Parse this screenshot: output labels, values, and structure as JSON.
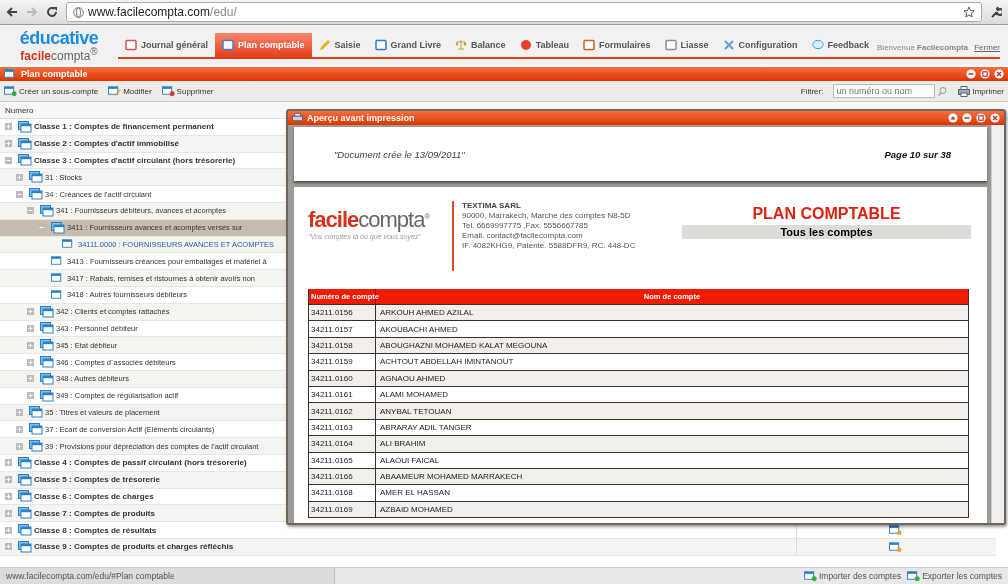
{
  "browser": {
    "url_host": "www.facilecompta.com",
    "url_path": "/edu/",
    "status": "www.facilecompta.com/edu/#Plan comptable"
  },
  "logo": {
    "top": "éducative",
    "brand_bold": "facile",
    "brand_light": "compta",
    "mark": "®"
  },
  "nav": [
    {
      "label": "Journal général",
      "selected": false
    },
    {
      "label": "Plan comptable",
      "selected": true
    },
    {
      "label": "Saisie",
      "selected": false
    },
    {
      "label": "Grand Livre",
      "selected": false
    },
    {
      "label": "Balance",
      "selected": false
    },
    {
      "label": "Tableau",
      "selected": false
    },
    {
      "label": "Formulaires",
      "selected": false
    },
    {
      "label": "Liasse",
      "selected": false
    },
    {
      "label": "Configuration",
      "selected": false
    },
    {
      "label": "Feedback",
      "selected": false
    }
  ],
  "user": {
    "greeting": "Bienvenue",
    "name": "Facilecompta",
    "logout": "Fermer"
  },
  "panel": {
    "title": "Plan comptable",
    "actions": [
      {
        "label": "Créer un sous-compte",
        "kind": "add"
      },
      {
        "label": "Modifier",
        "kind": "edit"
      },
      {
        "label": "Supprimer",
        "kind": "delete"
      }
    ],
    "filter_label": "Filtrer:",
    "filter_placeholder": "un numéro ou nom",
    "print": "Imprimer",
    "column_1": "Numero",
    "footer_actions": [
      "Importer des comptes",
      "Exporter les comptes"
    ]
  },
  "tree": [
    {
      "label": "Classe 1 : Comptes de financement permanent",
      "kind": "class",
      "expanded": false,
      "selected": false
    },
    {
      "label": "Classe 2 : Comptes d'actif immobilisé",
      "kind": "class",
      "expanded": false,
      "selected": false
    },
    {
      "label": "Classe 3 : Comptes d'actif circulant (hors trésorerie)",
      "kind": "class",
      "expanded": true,
      "selected": false,
      "children": [
        {
          "label": "31 : Stocks",
          "kind": "group",
          "expanded": false,
          "selected": false
        },
        {
          "label": "34 : Créances de l’actif circulant",
          "kind": "group",
          "expanded": true,
          "selected": false,
          "children": [
            {
              "label": "341 : Fournisseurs débiteurs, avances et acomptes",
              "kind": "group",
              "expanded": true,
              "selected": false,
              "children": [
                {
                  "label": "3411 : Fournisseurs  avances et acomptes versés sur",
                  "kind": "group",
                  "expanded": true,
                  "selected": true,
                  "children": [
                    {
                      "label": "34111.0000 : FOURNISSEURS AVANCES ET ACOMPTES",
                      "kind": "account",
                      "selected": false
                    }
                  ]
                },
                {
                  "label": "3413 : Fournisseurs  créances pour emballages et matériel à",
                  "kind": "leaf",
                  "selected": false
                },
                {
                  "label": "3417 : Rabais, remises et ristournes à obtenir  avoirs non",
                  "kind": "leaf",
                  "selected": false
                },
                {
                  "label": "3418 : Autres fournisseurs débiteurs",
                  "kind": "leaf",
                  "selected": false
                }
              ]
            },
            {
              "label": "342 : Clients et comptes rattachés",
              "kind": "group",
              "expanded": false,
              "selected": false
            },
            {
              "label": "343 : Personnel  débiteur",
              "kind": "group",
              "expanded": false,
              "selected": false
            },
            {
              "label": "345 : Etat  débiteur",
              "kind": "group",
              "expanded": false,
              "selected": false
            },
            {
              "label": "346 : Comptes d´associés  débiteurs",
              "kind": "group",
              "expanded": false,
              "selected": false
            },
            {
              "label": "348 : Autres débiteurs",
              "kind": "group",
              "expanded": false,
              "selected": false
            },
            {
              "label": "349 : Comptes de régularisation  actif",
              "kind": "group",
              "expanded": false,
              "selected": false
            }
          ]
        },
        {
          "label": "35 : Titres et valeurs de placement",
          "kind": "group",
          "expanded": false,
          "selected": false
        },
        {
          "label": "37 : Ecart de conversion  Actif (Eléments circulants)",
          "kind": "group",
          "expanded": false,
          "selected": false
        },
        {
          "label": "39 : Provisions pour dépréciation des comptes de l’actif circulant",
          "kind": "group",
          "expanded": false,
          "selected": false
        }
      ]
    },
    {
      "label": "Classe 4 : Comptes de passif circulant (hors trésorerie)",
      "kind": "class",
      "expanded": false,
      "selected": false
    },
    {
      "label": "Classe 5 : Comptes de trésorerie",
      "kind": "class",
      "expanded": false,
      "selected": false
    },
    {
      "label": "Classe 6 : Comptes de charges",
      "kind": "class",
      "expanded": false,
      "selected": false
    },
    {
      "label": "Classe 7 : Comptes de produits",
      "kind": "class",
      "expanded": false,
      "selected": false
    },
    {
      "label": "Classe 8 : Comptes de résultats",
      "kind": "class",
      "expanded": false,
      "selected": false,
      "editable": true
    },
    {
      "label": "Classe 9 : Comptes de produits et charges réfléchis",
      "kind": "class",
      "expanded": false,
      "selected": false,
      "editable": true
    }
  ],
  "preview": {
    "title": "Aperçu avant impression",
    "header_left": "\"Document crée le 13/09/2011\"",
    "header_right": "Page 10 sur 38",
    "brand_bold": "facile",
    "brand_light": "compta",
    "mark": "®",
    "tagline": "\"Vos comptes là où que vous soyez\"",
    "company": "TEXTIMA SARL",
    "address": [
      "90000, Marrakech, Marche des comptes N8-5D",
      "Tel. 6669997775 ,Fax. 5556667785",
      "Email. contact@facilecompta.com",
      "IF. 4082KHG9, Patente. 5588DFR9, RC. 448-DC"
    ],
    "doc_title": "PLAN COMPTABLE",
    "doc_subtitle": "Tous les comptes",
    "columns": [
      "Numéro de compte",
      "Nom de compte"
    ],
    "rows": [
      [
        "34211.0156",
        "ARKOUH AHMED AZILAL"
      ],
      [
        "34211.0157",
        "AKOUBACHI AHMED"
      ],
      [
        "34211.0158",
        "ABOUGHAZNI MOHAMED KALAT MEGOUNA"
      ],
      [
        "34211.0159",
        "ACHTOUT ABDELLAH IMINTANOUT"
      ],
      [
        "34211.0160",
        "AGNAOU AHMED"
      ],
      [
        "34211.0161",
        "ALAMI MOHAMED"
      ],
      [
        "34211.0162",
        "ANYBAL TETOUAN"
      ],
      [
        "34211.0163",
        "ABRARAY ADIL TANGER"
      ],
      [
        "34211.0164",
        "ALI BRAHIM"
      ],
      [
        "34211.0165",
        "ALAOUI FAICAL"
      ],
      [
        "34211.0166",
        "ABAAMEUR MOHAMED MARRAKECH"
      ],
      [
        "34211.0168",
        "AMER EL HASSAN"
      ],
      [
        "34211.0169",
        "AZBAID MOHAMED"
      ]
    ]
  }
}
